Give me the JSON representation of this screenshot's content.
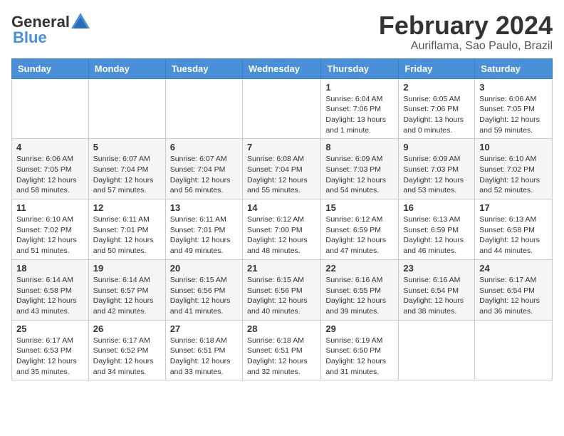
{
  "logo": {
    "text_general": "General",
    "text_blue": "Blue"
  },
  "title": "February 2024",
  "subtitle": "Auriflama, Sao Paulo, Brazil",
  "header_days": [
    "Sunday",
    "Monday",
    "Tuesday",
    "Wednesday",
    "Thursday",
    "Friday",
    "Saturday"
  ],
  "weeks": [
    [
      {
        "day": "",
        "info": ""
      },
      {
        "day": "",
        "info": ""
      },
      {
        "day": "",
        "info": ""
      },
      {
        "day": "",
        "info": ""
      },
      {
        "day": "1",
        "info": "Sunrise: 6:04 AM\nSunset: 7:06 PM\nDaylight: 13 hours\nand 1 minute."
      },
      {
        "day": "2",
        "info": "Sunrise: 6:05 AM\nSunset: 7:06 PM\nDaylight: 13 hours\nand 0 minutes."
      },
      {
        "day": "3",
        "info": "Sunrise: 6:06 AM\nSunset: 7:05 PM\nDaylight: 12 hours\nand 59 minutes."
      }
    ],
    [
      {
        "day": "4",
        "info": "Sunrise: 6:06 AM\nSunset: 7:05 PM\nDaylight: 12 hours\nand 58 minutes."
      },
      {
        "day": "5",
        "info": "Sunrise: 6:07 AM\nSunset: 7:04 PM\nDaylight: 12 hours\nand 57 minutes."
      },
      {
        "day": "6",
        "info": "Sunrise: 6:07 AM\nSunset: 7:04 PM\nDaylight: 12 hours\nand 56 minutes."
      },
      {
        "day": "7",
        "info": "Sunrise: 6:08 AM\nSunset: 7:04 PM\nDaylight: 12 hours\nand 55 minutes."
      },
      {
        "day": "8",
        "info": "Sunrise: 6:09 AM\nSunset: 7:03 PM\nDaylight: 12 hours\nand 54 minutes."
      },
      {
        "day": "9",
        "info": "Sunrise: 6:09 AM\nSunset: 7:03 PM\nDaylight: 12 hours\nand 53 minutes."
      },
      {
        "day": "10",
        "info": "Sunrise: 6:10 AM\nSunset: 7:02 PM\nDaylight: 12 hours\nand 52 minutes."
      }
    ],
    [
      {
        "day": "11",
        "info": "Sunrise: 6:10 AM\nSunset: 7:02 PM\nDaylight: 12 hours\nand 51 minutes."
      },
      {
        "day": "12",
        "info": "Sunrise: 6:11 AM\nSunset: 7:01 PM\nDaylight: 12 hours\nand 50 minutes."
      },
      {
        "day": "13",
        "info": "Sunrise: 6:11 AM\nSunset: 7:01 PM\nDaylight: 12 hours\nand 49 minutes."
      },
      {
        "day": "14",
        "info": "Sunrise: 6:12 AM\nSunset: 7:00 PM\nDaylight: 12 hours\nand 48 minutes."
      },
      {
        "day": "15",
        "info": "Sunrise: 6:12 AM\nSunset: 6:59 PM\nDaylight: 12 hours\nand 47 minutes."
      },
      {
        "day": "16",
        "info": "Sunrise: 6:13 AM\nSunset: 6:59 PM\nDaylight: 12 hours\nand 46 minutes."
      },
      {
        "day": "17",
        "info": "Sunrise: 6:13 AM\nSunset: 6:58 PM\nDaylight: 12 hours\nand 44 minutes."
      }
    ],
    [
      {
        "day": "18",
        "info": "Sunrise: 6:14 AM\nSunset: 6:58 PM\nDaylight: 12 hours\nand 43 minutes."
      },
      {
        "day": "19",
        "info": "Sunrise: 6:14 AM\nSunset: 6:57 PM\nDaylight: 12 hours\nand 42 minutes."
      },
      {
        "day": "20",
        "info": "Sunrise: 6:15 AM\nSunset: 6:56 PM\nDaylight: 12 hours\nand 41 minutes."
      },
      {
        "day": "21",
        "info": "Sunrise: 6:15 AM\nSunset: 6:56 PM\nDaylight: 12 hours\nand 40 minutes."
      },
      {
        "day": "22",
        "info": "Sunrise: 6:16 AM\nSunset: 6:55 PM\nDaylight: 12 hours\nand 39 minutes."
      },
      {
        "day": "23",
        "info": "Sunrise: 6:16 AM\nSunset: 6:54 PM\nDaylight: 12 hours\nand 38 minutes."
      },
      {
        "day": "24",
        "info": "Sunrise: 6:17 AM\nSunset: 6:54 PM\nDaylight: 12 hours\nand 36 minutes."
      }
    ],
    [
      {
        "day": "25",
        "info": "Sunrise: 6:17 AM\nSunset: 6:53 PM\nDaylight: 12 hours\nand 35 minutes."
      },
      {
        "day": "26",
        "info": "Sunrise: 6:17 AM\nSunset: 6:52 PM\nDaylight: 12 hours\nand 34 minutes."
      },
      {
        "day": "27",
        "info": "Sunrise: 6:18 AM\nSunset: 6:51 PM\nDaylight: 12 hours\nand 33 minutes."
      },
      {
        "day": "28",
        "info": "Sunrise: 6:18 AM\nSunset: 6:51 PM\nDaylight: 12 hours\nand 32 minutes."
      },
      {
        "day": "29",
        "info": "Sunrise: 6:19 AM\nSunset: 6:50 PM\nDaylight: 12 hours\nand 31 minutes."
      },
      {
        "day": "",
        "info": ""
      },
      {
        "day": "",
        "info": ""
      }
    ]
  ]
}
